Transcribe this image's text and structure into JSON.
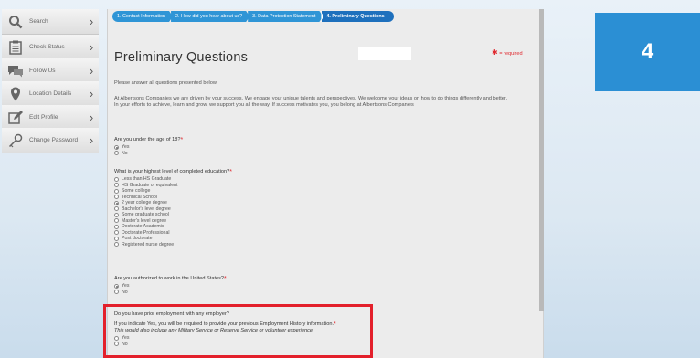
{
  "sidebar": {
    "items": [
      {
        "label": "Search",
        "icon": "search-icon"
      },
      {
        "label": "Check Status",
        "icon": "clipboard-icon"
      },
      {
        "label": "Follow Us",
        "icon": "chat-bubble-icon"
      },
      {
        "label": "Location Details",
        "icon": "location-pin-icon"
      },
      {
        "label": "Edit Profile",
        "icon": "pencil-icon"
      },
      {
        "label": "Change Password",
        "icon": "key-icon"
      }
    ]
  },
  "steps": [
    "1. Contact Information",
    "2. How did you hear about us?",
    "3. Data Protection Statement",
    "4. Preliminary Questions"
  ],
  "page": {
    "title": "Preliminary Questions",
    "required_note": "= required",
    "intro": "Please answer all questions presented below.",
    "mission_line1": "At Albertsons Companies we are driven by your success. We engage your unique talents and perspectives. We welcome your ideas on how to do things differently and better.",
    "mission_line2": "In your efforts to achieve, learn and grow, we support you all the way. If success motivates you, you belong at Albertsons Companies"
  },
  "questions": {
    "age": {
      "label": "Are you under the age of 18?",
      "options": [
        "Yes",
        "No"
      ],
      "selected": "Yes"
    },
    "education": {
      "label": "What is your highest level of completed education?",
      "options": [
        "Less than HS Graduate",
        "HS Graduate or equivalent",
        "Some college",
        "Technical School",
        "2 year college degree",
        "Bachelor's level degree",
        "Some graduate school",
        "Master's level degree",
        "Doctorate Academic",
        "Doctorate Professional",
        "Post doctorate",
        "Registered nurse degree"
      ],
      "selected": "2 year college degree"
    },
    "authorized": {
      "label": "Are you authorized to work in the United States?",
      "options": [
        "Yes",
        "No"
      ],
      "selected": "Yes"
    },
    "prior": {
      "label": "Do you have prior employment with any employer?",
      "note": "If you indicate Yes, you will be required to provide your previous Employment History information.",
      "note_italic": "This would also include any Military Service or Reserve Service or volunteer experience.",
      "options": [
        "Yes",
        "No"
      ],
      "selected": ""
    }
  },
  "badge": "4",
  "colors": {
    "step": "#2f95d6",
    "step_active": "#1e70bd",
    "required": "#e02a30",
    "highlight": "#e3202b",
    "badge": "#2b8fd4"
  }
}
